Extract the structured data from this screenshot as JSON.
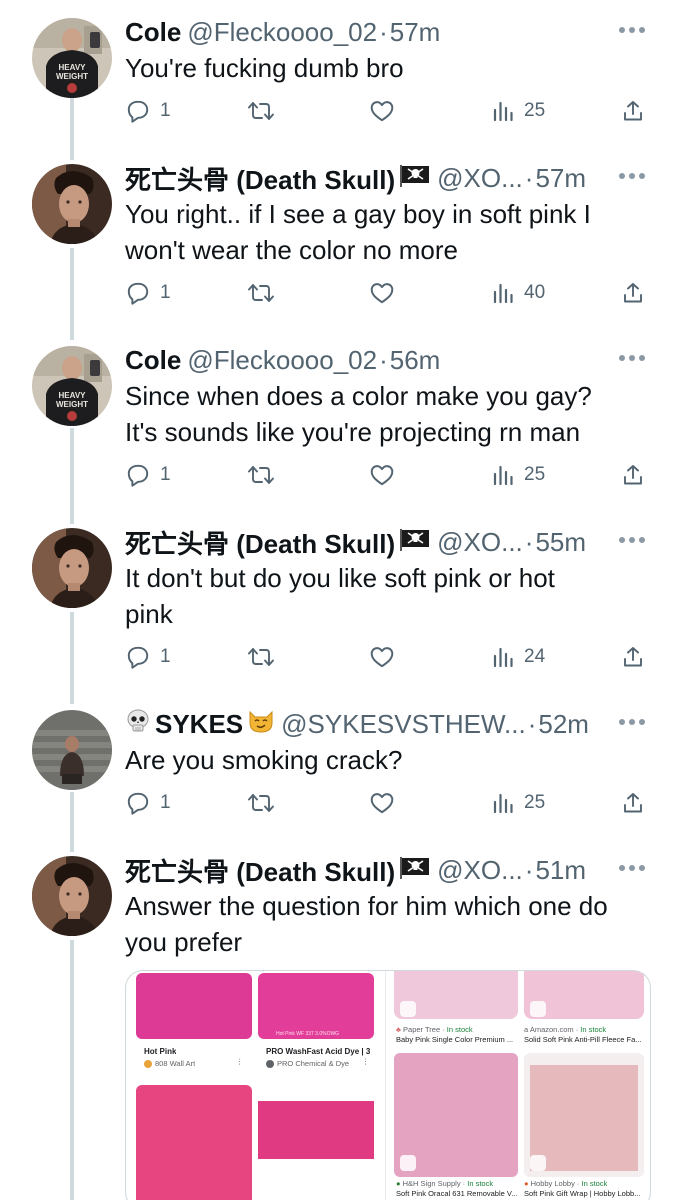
{
  "tweets": [
    {
      "name": "Cole",
      "handle": "@Fleckoooo_02",
      "separator": "·",
      "time": "57m",
      "text": "You're fucking dumb bro",
      "replies": "1",
      "views": "25",
      "avatar": "cole"
    },
    {
      "name": "死亡头骨 (Death Skull)",
      "handle": "@XO...",
      "separator": "·",
      "time": "57m",
      "text_lines": [
        "You right..  if I see a gay boy in soft pink I",
        "won't wear the color no more"
      ],
      "replies": "1",
      "views": "40",
      "avatar": "deathskull"
    },
    {
      "name": "Cole",
      "handle": "@Fleckoooo_02",
      "separator": "·",
      "time": "56m",
      "text_lines": [
        "Since when does a color make you gay?",
        "It's sounds like you're projecting rn man"
      ],
      "replies": "1",
      "views": "25",
      "avatar": "cole"
    },
    {
      "name": "死亡头骨 (Death Skull)",
      "handle": "@XO...",
      "separator": "·",
      "time": "55m",
      "text_lines": [
        "It don't but do you like soft pink or hot",
        "pink"
      ],
      "replies": "1",
      "views": "24",
      "avatar": "deathskull"
    },
    {
      "name": "SYKES",
      "handle": "@SYKESVSTHEW...",
      "separator": "·",
      "time": "52m",
      "text": "Are you smoking crack?",
      "replies": "1",
      "views": "25",
      "avatar": "sykes"
    },
    {
      "name": "死亡头骨 (Death Skull)",
      "handle": "@XO...",
      "separator": "·",
      "time": "51m",
      "text_lines": [
        "Answer the question for him which one do",
        "you prefer"
      ],
      "avatar": "deathskull"
    }
  ],
  "media": {
    "left": {
      "hot_pink_title": "Hot Pink",
      "hot_pink_source": "808 Wall Art",
      "wash_label_small": "Hot Pink WF 337   3.0%OWG",
      "wash_title": "PRO WashFast Acid Dye | 3...",
      "wash_source": "PRO Chemical & Dye"
    },
    "right": {
      "r1_source": "Paper Tree",
      "r1_stock": "In stock",
      "r1_title": "Baby Pink Single Color Premium ...",
      "r2_source": "Amazon.com",
      "r2_stock": "In stock",
      "r2_title": "Solid Soft Pink Anti-Pill Fleece Fa...",
      "r3_source": "H&H Sign Supply",
      "r3_stock": "In stock",
      "r3_title": "Soft Pink Oracal 631 Removable V...",
      "r4_source": "Hobby Lobby",
      "r4_stock": "In stock",
      "r4_title": "Soft Pink Gift Wrap | Hobby Lobb..."
    }
  },
  "colors": {
    "text_primary": "#0f1419",
    "text_secondary": "#536471",
    "thread_line": "#cfd9de",
    "hot_pink": "#e0368f",
    "soft_pink": "#e8a7c4",
    "baby_pink": "#efc7da"
  },
  "icons": [
    "reply-icon",
    "retweet-icon",
    "like-icon",
    "views-icon",
    "share-icon",
    "more-icon",
    "pirate-flag-icon",
    "skull-icon",
    "cat-emoji-icon"
  ]
}
